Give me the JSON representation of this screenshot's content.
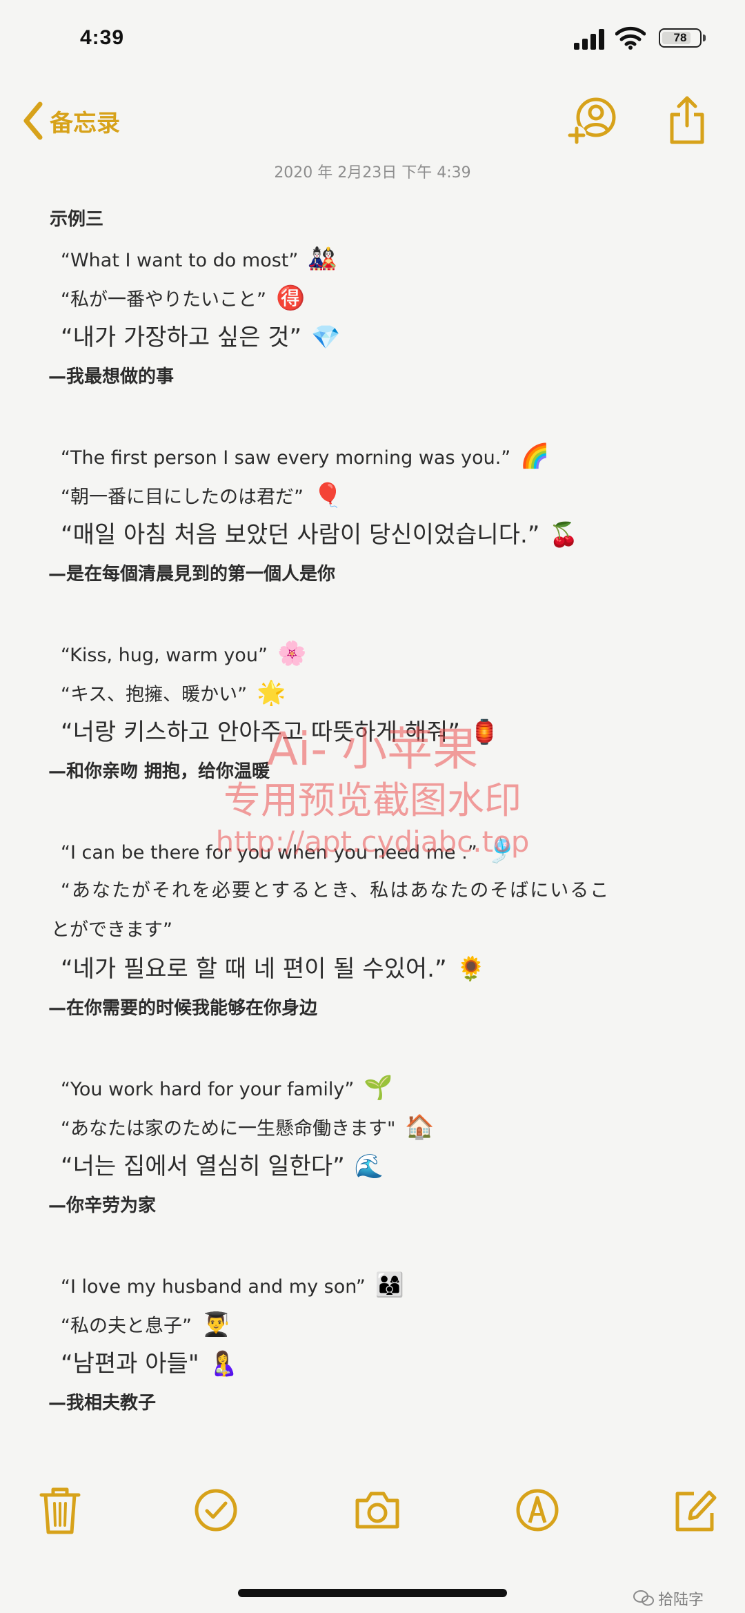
{
  "status_bar": {
    "time": "4:39",
    "battery": "78"
  },
  "nav": {
    "back_label": "备忘录"
  },
  "note": {
    "date": "2020 年 2月23日 下午 4:39",
    "title": "示例三",
    "groups": [
      {
        "en": "“What I want to do most”",
        "en_emoji": "🎎",
        "ja": "“私が一番やりたいこと”",
        "ja_emoji": "🉐",
        "ko": "“내가 가장하고 싶은 것”",
        "ko_emoji": "💎",
        "zh": "—我最想做的事"
      },
      {
        "en": "“The first person I saw every morning was you.”",
        "en_emoji": "🌈",
        "ja": "“朝一番に目にしたのは君だ”",
        "ja_emoji": "🎈",
        "ko": "“매일 아침 처음 보았던 사람이 당신이었습니다.”",
        "ko_emoji": "🍒",
        "zh": "—是在每個清晨見到的第一個人是你"
      },
      {
        "en": "“Kiss, hug, warm you”",
        "en_emoji": "🌸",
        "ja": "“キス、抱擁、暖かい”",
        "ja_emoji": "🌟",
        "ko": "“너랑 키스하고 안아주고 따뜻하게 해줘”",
        "ko_emoji": "🏮",
        "zh": "—和你亲吻 拥抱，给你温暖"
      },
      {
        "en": "“I can be there for you when you need me .”",
        "en_emoji": "🎐",
        "ja": "“あなたがそれを必要とするとき、私はあなたのそばにいるこ",
        "ja_cont": "とができます”",
        "ko": "“네가 필요로 할 때 네 편이 될 수있어.”",
        "ko_emoji": "🌻",
        "zh": "—在你需要的时候我能够在你身边"
      },
      {
        "en": "“You work hard for your family”",
        "en_emoji": "🌱",
        "ja": "“あなたは家のために一生懸命働きます\"",
        "ja_emoji": "🏠",
        "ko": "“너는 집에서 열심히 일한다”",
        "ko_emoji": "🌊",
        "zh": "—你辛劳为家"
      },
      {
        "en": "“I love my husband and my son”",
        "en_emoji": "👨‍👩‍👦",
        "ja": "“私の夫と息子”",
        "ja_emoji": "👨‍🎓",
        "ko": "“남편과 아들\"",
        "ko_emoji": "🤱",
        "zh": "—我相夫教子"
      }
    ]
  },
  "watermark": {
    "line1": "Ai- 小苹果",
    "line2": "专用预览截图水印",
    "line3": "http://apt.cydiabc.top"
  },
  "footer": {
    "wechat_label": "拾陆字"
  },
  "colors": {
    "accent": "#d7a21a",
    "background": "#f5f5f3",
    "watermark": "#eb5050"
  }
}
